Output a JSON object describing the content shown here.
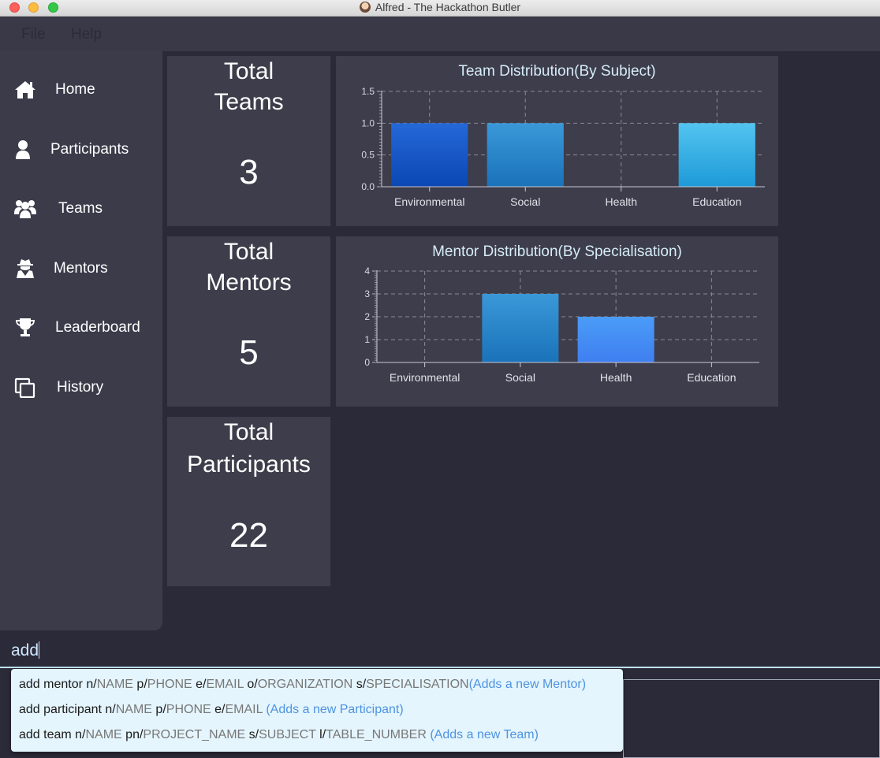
{
  "window": {
    "title": "Alfred - The Hackathon Butler"
  },
  "menu": [
    "File",
    "Help"
  ],
  "sidebar": {
    "items": [
      {
        "label": "Home",
        "icon": "home-icon"
      },
      {
        "label": "Participants",
        "icon": "user-icon"
      },
      {
        "label": "Teams",
        "icon": "users-icon"
      },
      {
        "label": "Mentors",
        "icon": "user-secret-icon"
      },
      {
        "label": "Leaderboard",
        "icon": "trophy-icon"
      },
      {
        "label": "History",
        "icon": "copy-icon"
      }
    ]
  },
  "stats": [
    {
      "title_line1": "Total",
      "title_line2": "Teams",
      "value": "3"
    },
    {
      "title_line1": "Total",
      "title_line2": "Mentors",
      "value": "5"
    },
    {
      "title_line1": "Total",
      "title_line2": "Participants",
      "value": "22"
    }
  ],
  "chart_data": [
    {
      "type": "bar",
      "title": "Team Distribution(By Subject)",
      "categories": [
        "Environmental",
        "Social",
        "Health",
        "Education"
      ],
      "values": [
        1,
        1,
        0,
        1
      ],
      "ylim": [
        0,
        1.5
      ],
      "yticks": [
        "0.0",
        "0.5",
        "1.0",
        "1.5"
      ],
      "grid": true,
      "bar_colors": [
        [
          "#2568d8",
          "#0a47b3"
        ],
        [
          "#3a98d8",
          "#1a72b9"
        ],
        [
          "#4da6f0",
          "#2a80d8"
        ],
        [
          "#52c4f0",
          "#1e9ad8"
        ]
      ]
    },
    {
      "type": "bar",
      "title": "Mentor Distribution(By Specialisation)",
      "categories": [
        "Environmental",
        "Social",
        "Health",
        "Education"
      ],
      "values": [
        0,
        3,
        2,
        0
      ],
      "ylim": [
        0,
        4
      ],
      "yticks": [
        "0",
        "1",
        "2",
        "3",
        "4"
      ],
      "grid": true,
      "bar_colors": [
        [
          "#2568d8",
          "#0a47b3"
        ],
        [
          "#3a98d8",
          "#1a72b9"
        ],
        [
          "#4a9cf8",
          "#3f7ff0"
        ],
        [
          "#52c4f0",
          "#1e9ad8"
        ]
      ]
    }
  ],
  "command": {
    "value": "add"
  },
  "suggestions": [
    [
      {
        "t": "add mentor n/",
        "k": "cmd"
      },
      {
        "t": "NAME",
        "k": "ph"
      },
      {
        "t": " p/",
        "k": "cmd"
      },
      {
        "t": "PHONE",
        "k": "ph"
      },
      {
        "t": " e/",
        "k": "cmd"
      },
      {
        "t": "EMAIL",
        "k": "ph"
      },
      {
        "t": " o/",
        "k": "cmd"
      },
      {
        "t": "ORGANIZATION",
        "k": "ph"
      },
      {
        "t": " s/",
        "k": "cmd"
      },
      {
        "t": "SPECIALISATION",
        "k": "ph"
      },
      {
        "t": "(Adds a new Mentor)",
        "k": "ds"
      }
    ],
    [
      {
        "t": "add participant n/",
        "k": "cmd"
      },
      {
        "t": "NAME",
        "k": "ph"
      },
      {
        "t": " p/",
        "k": "cmd"
      },
      {
        "t": "PHONE",
        "k": "ph"
      },
      {
        "t": " e/",
        "k": "cmd"
      },
      {
        "t": "EMAIL",
        "k": "ph"
      },
      {
        "t": " (Adds a new Participant)",
        "k": "ds"
      }
    ],
    [
      {
        "t": "add team n/",
        "k": "cmd"
      },
      {
        "t": "NAME",
        "k": "ph"
      },
      {
        "t": " pn/",
        "k": "cmd"
      },
      {
        "t": "PROJECT_NAME",
        "k": "ph"
      },
      {
        "t": " s/",
        "k": "cmd"
      },
      {
        "t": "SUBJECT",
        "k": "ph"
      },
      {
        "t": " l/",
        "k": "cmd"
      },
      {
        "t": "TABLE_NUMBER",
        "k": "ph"
      },
      {
        "t": " (Adds a new Team)",
        "k": "ds"
      }
    ]
  ]
}
